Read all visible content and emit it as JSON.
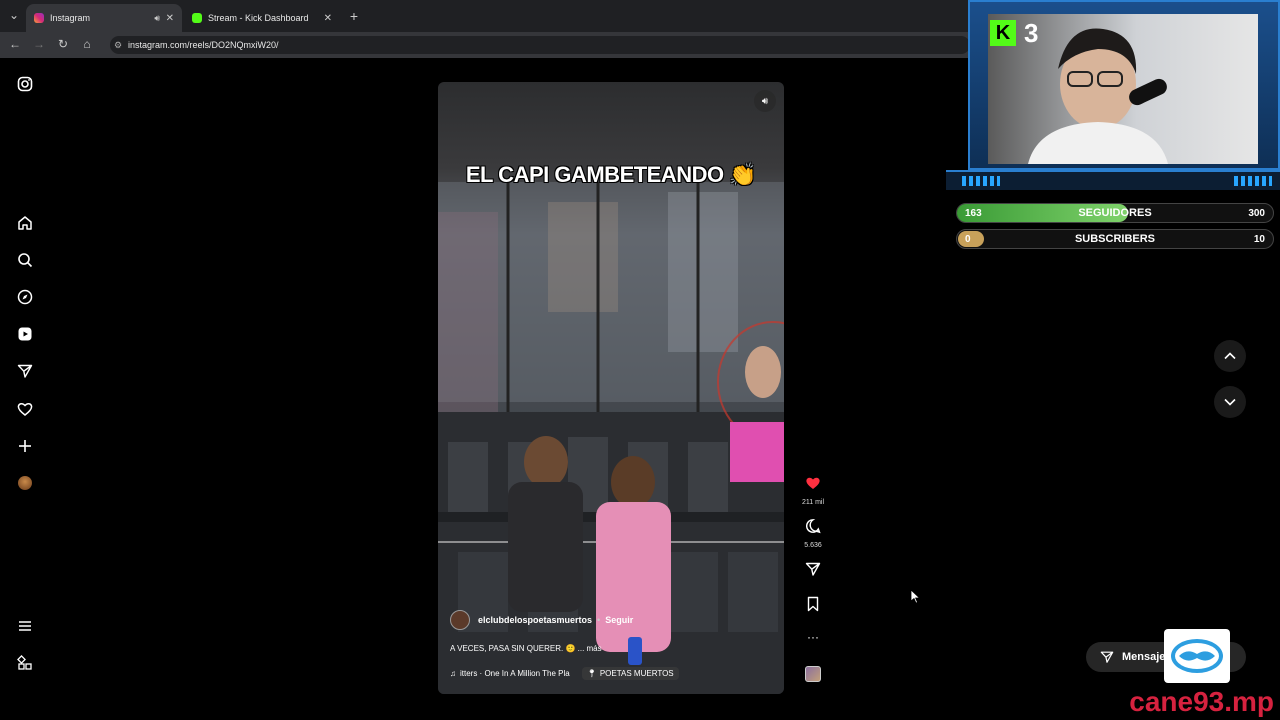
{
  "browser": {
    "tabs": [
      {
        "title": "Instagram"
      },
      {
        "title": "Stream - Kick Dashboard"
      }
    ],
    "url": "instagram.com/reels/DO2NQmxiW20/"
  },
  "reel": {
    "caption_overlay": "EL CAPI GAMBETEANDO 👏",
    "username": "elclubdelospoetasmuertos",
    "follow_label": "Seguir",
    "description": "A VECES, PASA SIN QUERER. 🙂 ... más",
    "audio": "itters · One In A Million    The Pla",
    "location": "POETAS MUERTOS",
    "likes": "211 mil",
    "comments": "5.636"
  },
  "stream_overlay": {
    "level": "3",
    "seguidores": {
      "current": "163",
      "label": "SEGUIDORES",
      "goal": "300",
      "progress": 0.54
    },
    "subscribers": {
      "current": "0",
      "label": "SUBSCRIBERS",
      "goal": "10",
      "progress": 0.0
    }
  },
  "messages_label": "Mensajes",
  "watermark": "cane93.mp",
  "colors": {
    "like": "#ff3040",
    "progress_green": "#5bbf4b",
    "kick_green": "#53fc18",
    "watermark": "#d6223f"
  }
}
